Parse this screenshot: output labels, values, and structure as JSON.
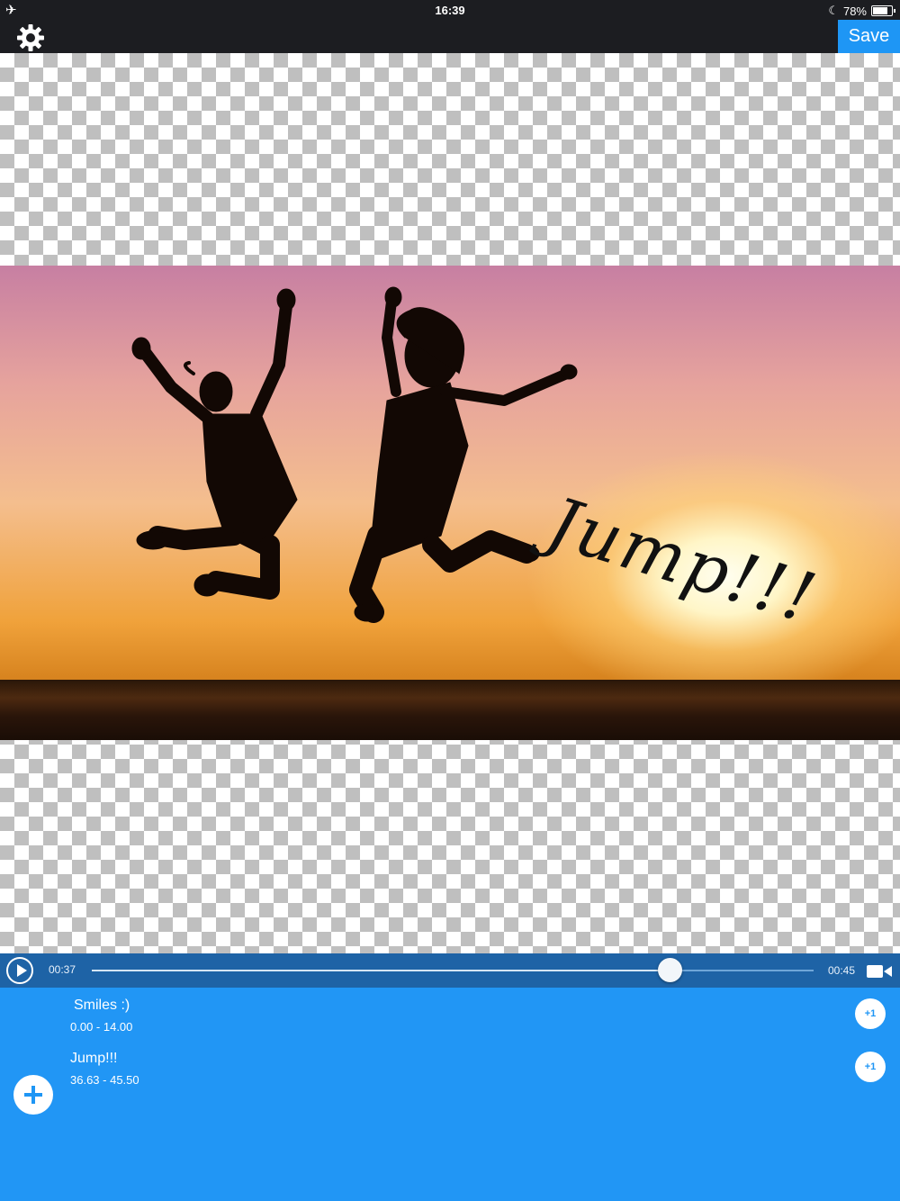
{
  "status_bar": {
    "time": "16:39",
    "battery": "78%",
    "battery_level": 0.78,
    "icons": [
      "airplane-icon",
      "moon-icon",
      "battery-icon"
    ]
  },
  "toolbar": {
    "settings_icon": "gear-icon",
    "save_label": "Save"
  },
  "canvas": {
    "overlay_text": "Jump!!!"
  },
  "playback": {
    "current_time": "00:37",
    "total_time": "00:45",
    "progress": 0.8,
    "icons": [
      "play-icon",
      "video-camera-icon"
    ]
  },
  "clips": [
    {
      "title": "Smiles :)",
      "range": "0.00 - 14.00",
      "action": "+1"
    },
    {
      "title": "Jump!!!",
      "range": "36.63 - 45.50",
      "action": "+1"
    }
  ],
  "add_icon": "plus-icon",
  "colors": {
    "accent": "#2196f5",
    "save_button": "#1e96f5",
    "playback_bar": "#1e63a6",
    "toolbar": "#1c1d21"
  }
}
